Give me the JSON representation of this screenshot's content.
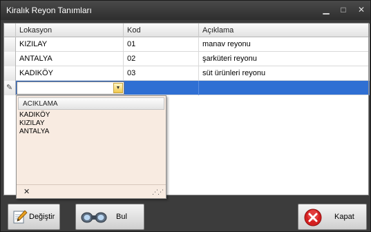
{
  "window": {
    "title": "Kiralık Reyon Tanımları"
  },
  "grid": {
    "columns": [
      "Lokasyon",
      "Kod",
      "Açıklama"
    ],
    "rows": [
      {
        "lokasyon": "KIZILAY",
        "kod": "01",
        "aciklama": "manav reyonu"
      },
      {
        "lokasyon": "ANTALYA",
        "kod": "02",
        "aciklama": "şarküteri reyonu"
      },
      {
        "lokasyon": "KADIKÖY",
        "kod": "03",
        "aciklama": "süt ürünleri reyonu"
      }
    ],
    "edit_row": {
      "lokasyon": "",
      "kod": "",
      "aciklama": ""
    }
  },
  "dropdown": {
    "header": "ACIKLAMA",
    "items": [
      "KADIKÖY",
      "KIZILAY",
      "ANTALYA"
    ],
    "close_glyph": "✕"
  },
  "buttons": {
    "degistir": "Değiştir",
    "bul": "Bul",
    "kapat": "Kapat"
  },
  "colors": {
    "selection": "#2f6fd3",
    "popup_bg": "#f8ebe1",
    "window_bg": "#3c3c3c"
  },
  "icons": {
    "degistir": "pencil-edit-icon",
    "bul": "binoculars-icon",
    "kapat": "red-close-icon"
  }
}
